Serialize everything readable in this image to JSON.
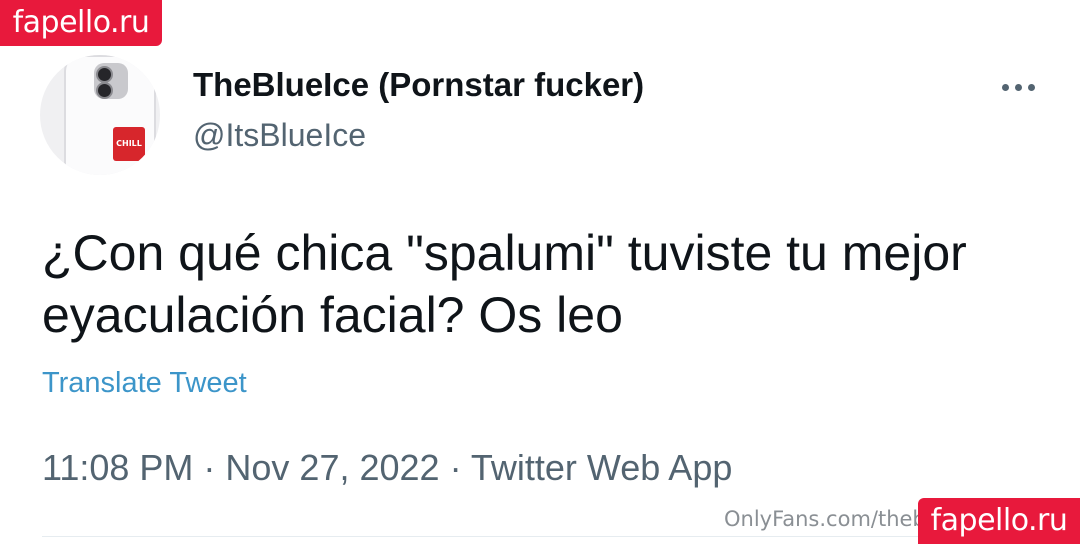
{
  "watermark": {
    "top_label": "fapello.ru",
    "bottom_label": "fapello.ru",
    "onlyfans_text": "OnlyFans.com/theb",
    "color": "#e8193c"
  },
  "tweet": {
    "author": {
      "display_name": "TheBlueIce (Pornstar fucker)",
      "handle": "@ItsBlueIce",
      "avatar_icon": "phone-with-sticker-avatar",
      "avatar_sticker_text": "CHILL"
    },
    "more_icon": "more-horizontal-icon",
    "text": "¿Con qué chica \"spalumi\" tuviste tu mejor eyaculación facial? Os leo",
    "translate_label": "Translate Tweet",
    "meta": "11:08 PM · Nov 27, 2022 · Twitter Web App"
  },
  "colors": {
    "text": "#0f1419",
    "secondary": "#536471",
    "link": "#3c95c9"
  }
}
